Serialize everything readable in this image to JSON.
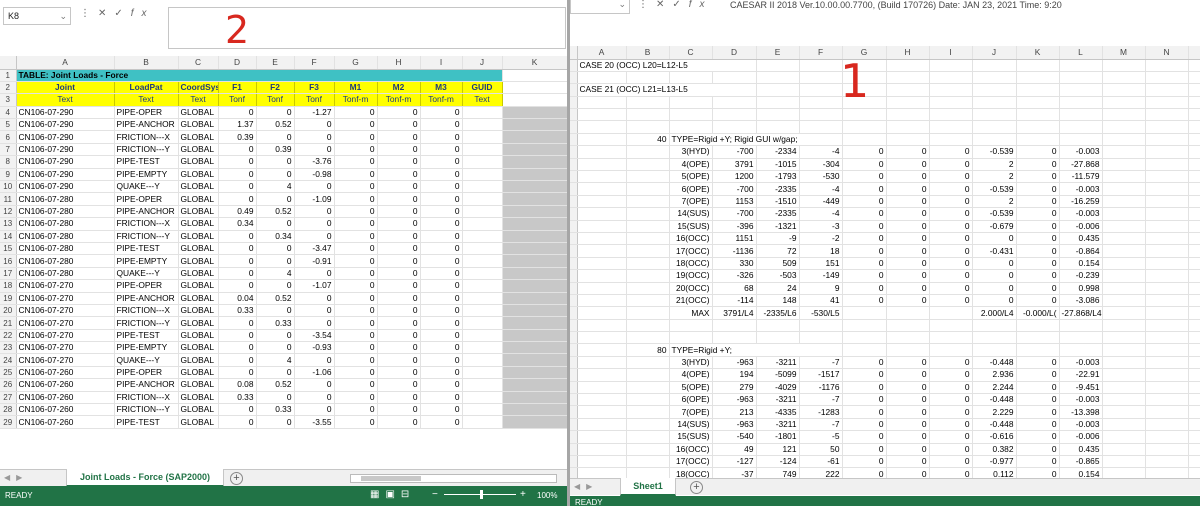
{
  "left": {
    "name_box": "K8",
    "annotation": "2",
    "columns": [
      "A",
      "B",
      "C",
      "D",
      "E",
      "F",
      "G",
      "H",
      "I",
      "J",
      "K"
    ],
    "table_title": "TABLE:  Joint Loads - Force",
    "headers": [
      "Joint",
      "LoadPat",
      "CoordSys",
      "F1",
      "F2",
      "F3",
      "M1",
      "M2",
      "M3",
      "GUID"
    ],
    "units": [
      "Text",
      "Text",
      "Text",
      "Tonf",
      "Tonf",
      "Tonf",
      "Tonf-m",
      "Tonf-m",
      "Tonf-m",
      "Text"
    ],
    "rows": [
      [
        "CN106-07-290",
        "PIPE-OPER",
        "GLOBAL",
        "0",
        "0",
        "-1.27",
        "0",
        "0",
        "0"
      ],
      [
        "CN106-07-290",
        "PIPE-ANCHOR",
        "GLOBAL",
        "1.37",
        "0.52",
        "0",
        "0",
        "0",
        "0"
      ],
      [
        "CN106-07-290",
        "FRICTION---X",
        "GLOBAL",
        "0.39",
        "0",
        "0",
        "0",
        "0",
        "0"
      ],
      [
        "CN106-07-290",
        "FRICTION---Y",
        "GLOBAL",
        "0",
        "0.39",
        "0",
        "0",
        "0",
        "0"
      ],
      [
        "CN106-07-290",
        "PIPE-TEST",
        "GLOBAL",
        "0",
        "0",
        "-3.76",
        "0",
        "0",
        "0"
      ],
      [
        "CN106-07-290",
        "PIPE-EMPTY",
        "GLOBAL",
        "0",
        "0",
        "-0.98",
        "0",
        "0",
        "0"
      ],
      [
        "CN106-07-290",
        "QUAKE---Y",
        "GLOBAL",
        "0",
        "4",
        "0",
        "0",
        "0",
        "0"
      ],
      [
        "CN106-07-280",
        "PIPE-OPER",
        "GLOBAL",
        "0",
        "0",
        "-1.09",
        "0",
        "0",
        "0"
      ],
      [
        "CN106-07-280",
        "PIPE-ANCHOR",
        "GLOBAL",
        "0.49",
        "0.52",
        "0",
        "0",
        "0",
        "0"
      ],
      [
        "CN106-07-280",
        "FRICTION---X",
        "GLOBAL",
        "0.34",
        "0",
        "0",
        "0",
        "0",
        "0"
      ],
      [
        "CN106-07-280",
        "FRICTION---Y",
        "GLOBAL",
        "0",
        "0.34",
        "0",
        "0",
        "0",
        "0"
      ],
      [
        "CN106-07-280",
        "PIPE-TEST",
        "GLOBAL",
        "0",
        "0",
        "-3.47",
        "0",
        "0",
        "0"
      ],
      [
        "CN106-07-280",
        "PIPE-EMPTY",
        "GLOBAL",
        "0",
        "0",
        "-0.91",
        "0",
        "0",
        "0"
      ],
      [
        "CN106-07-280",
        "QUAKE---Y",
        "GLOBAL",
        "0",
        "4",
        "0",
        "0",
        "0",
        "0"
      ],
      [
        "CN106-07-270",
        "PIPE-OPER",
        "GLOBAL",
        "0",
        "0",
        "-1.07",
        "0",
        "0",
        "0"
      ],
      [
        "CN106-07-270",
        "PIPE-ANCHOR",
        "GLOBAL",
        "0.04",
        "0.52",
        "0",
        "0",
        "0",
        "0"
      ],
      [
        "CN106-07-270",
        "FRICTION---X",
        "GLOBAL",
        "0.33",
        "0",
        "0",
        "0",
        "0",
        "0"
      ],
      [
        "CN106-07-270",
        "FRICTION---Y",
        "GLOBAL",
        "0",
        "0.33",
        "0",
        "0",
        "0",
        "0"
      ],
      [
        "CN106-07-270",
        "PIPE-TEST",
        "GLOBAL",
        "0",
        "0",
        "-3.54",
        "0",
        "0",
        "0"
      ],
      [
        "CN106-07-270",
        "PIPE-EMPTY",
        "GLOBAL",
        "0",
        "0",
        "-0.93",
        "0",
        "0",
        "0"
      ],
      [
        "CN106-07-270",
        "QUAKE---Y",
        "GLOBAL",
        "0",
        "4",
        "0",
        "0",
        "0",
        "0"
      ],
      [
        "CN106-07-260",
        "PIPE-OPER",
        "GLOBAL",
        "0",
        "0",
        "-1.06",
        "0",
        "0",
        "0"
      ],
      [
        "CN106-07-260",
        "PIPE-ANCHOR",
        "GLOBAL",
        "0.08",
        "0.52",
        "0",
        "0",
        "0",
        "0"
      ],
      [
        "CN106-07-260",
        "FRICTION---X",
        "GLOBAL",
        "0.33",
        "0",
        "0",
        "0",
        "0",
        "0"
      ],
      [
        "CN106-07-260",
        "FRICTION---Y",
        "GLOBAL",
        "0",
        "0.33",
        "0",
        "0",
        "0",
        "0"
      ],
      [
        "CN106-07-260",
        "PIPE-TEST",
        "GLOBAL",
        "0",
        "0",
        "-3.55",
        "0",
        "0",
        "0"
      ]
    ],
    "sheet_tab": "Joint Loads - Force (SAP2000)",
    "status": "READY",
    "zoom": "100%"
  },
  "right": {
    "name_box": "",
    "formula": "CAESAR II 2018  Ver.10.00.00.7700,  (Build 170726)  Date: JAN 23, 2021  Time: 9:20",
    "annotation": "1",
    "columns": [
      "A",
      "B",
      "C",
      "D",
      "E",
      "F",
      "G",
      "H",
      "I",
      "J",
      "K",
      "L",
      "M",
      "N"
    ],
    "case_lines": [
      "CASE 20 (OCC) L20=L12-L5",
      "CASE 21 (OCC) L21=L13-L5"
    ],
    "block1": {
      "node": "40",
      "type_line": "TYPE=Rigid +Y; Rigid GUI w/gap;",
      "rows": [
        [
          "3(HYD)",
          "-700",
          "-2334",
          "-4",
          "0",
          "0",
          "0",
          "-0.539",
          "0",
          "-0.003"
        ],
        [
          "4(OPE)",
          "3791",
          "-1015",
          "-304",
          "0",
          "0",
          "0",
          "2",
          "0",
          "-27.868"
        ],
        [
          "5(OPE)",
          "1200",
          "-1793",
          "-530",
          "0",
          "0",
          "0",
          "2",
          "0",
          "-11.579"
        ],
        [
          "6(OPE)",
          "-700",
          "-2335",
          "-4",
          "0",
          "0",
          "0",
          "-0.539",
          "0",
          "-0.003"
        ],
        [
          "7(OPE)",
          "1153",
          "-1510",
          "-449",
          "0",
          "0",
          "0",
          "2",
          "0",
          "-16.259"
        ],
        [
          "14(SUS)",
          "-700",
          "-2335",
          "-4",
          "0",
          "0",
          "0",
          "-0.539",
          "0",
          "-0.003"
        ],
        [
          "15(SUS)",
          "-396",
          "-1321",
          "-3",
          "0",
          "0",
          "0",
          "-0.679",
          "0",
          "-0.006"
        ],
        [
          "16(OCC)",
          "1151",
          "-9",
          "-2",
          "0",
          "0",
          "0",
          "0",
          "0",
          "0.435"
        ],
        [
          "17(OCC)",
          "-1136",
          "72",
          "18",
          "0",
          "0",
          "0",
          "-0.431",
          "0",
          "-0.864"
        ],
        [
          "18(OCC)",
          "330",
          "509",
          "151",
          "0",
          "0",
          "0",
          "0",
          "0",
          "0.154"
        ],
        [
          "19(OCC)",
          "-326",
          "-503",
          "-149",
          "0",
          "0",
          "0",
          "0",
          "0",
          "-0.239"
        ],
        [
          "20(OCC)",
          "68",
          "24",
          "9",
          "0",
          "0",
          "0",
          "0",
          "0",
          "0.998"
        ],
        [
          "21(OCC)",
          "-114",
          "148",
          "41",
          "0",
          "0",
          "0",
          "0",
          "0",
          "-3.086"
        ]
      ],
      "max_label": "MAX",
      "max_values": [
        "3791/L4",
        "-2335/L6",
        "-530/L5",
        "",
        "",
        "",
        "2.000/L4",
        "-0.000/L(",
        "-27.868/L4"
      ]
    },
    "block2": {
      "node": "80",
      "type_line": "TYPE=Rigid +Y;",
      "rows": [
        [
          "3(HYD)",
          "-963",
          "-3211",
          "-7",
          "0",
          "0",
          "0",
          "-0.448",
          "0",
          "-0.003"
        ],
        [
          "4(OPE)",
          "194",
          "-5099",
          "-1517",
          "0",
          "0",
          "0",
          "2.936",
          "0",
          "-22.91"
        ],
        [
          "5(OPE)",
          "279",
          "-4029",
          "-1176",
          "0",
          "0",
          "0",
          "2.244",
          "0",
          "-9.451"
        ],
        [
          "6(OPE)",
          "-963",
          "-3211",
          "-7",
          "0",
          "0",
          "0",
          "-0.448",
          "0",
          "-0.003"
        ],
        [
          "7(OPE)",
          "213",
          "-4335",
          "-1283",
          "0",
          "0",
          "0",
          "2.229",
          "0",
          "-13.398"
        ],
        [
          "14(SUS)",
          "-963",
          "-3211",
          "-7",
          "0",
          "0",
          "0",
          "-0.448",
          "0",
          "-0.003"
        ],
        [
          "15(SUS)",
          "-540",
          "-1801",
          "-5",
          "0",
          "0",
          "0",
          "-0.616",
          "0",
          "-0.006"
        ],
        [
          "16(OCC)",
          "49",
          "121",
          "50",
          "0",
          "0",
          "0",
          "0.382",
          "0",
          "0.435"
        ],
        [
          "17(OCC)",
          "-127",
          "-124",
          "-61",
          "0",
          "0",
          "0",
          "-0.977",
          "0",
          "-0.865"
        ],
        [
          "18(OCC)",
          "-37",
          "749",
          "222",
          "0",
          "0",
          "0",
          "0.112",
          "0",
          "0.154"
        ]
      ]
    },
    "sheet_tab": "Sheet1",
    "status": "READY"
  }
}
